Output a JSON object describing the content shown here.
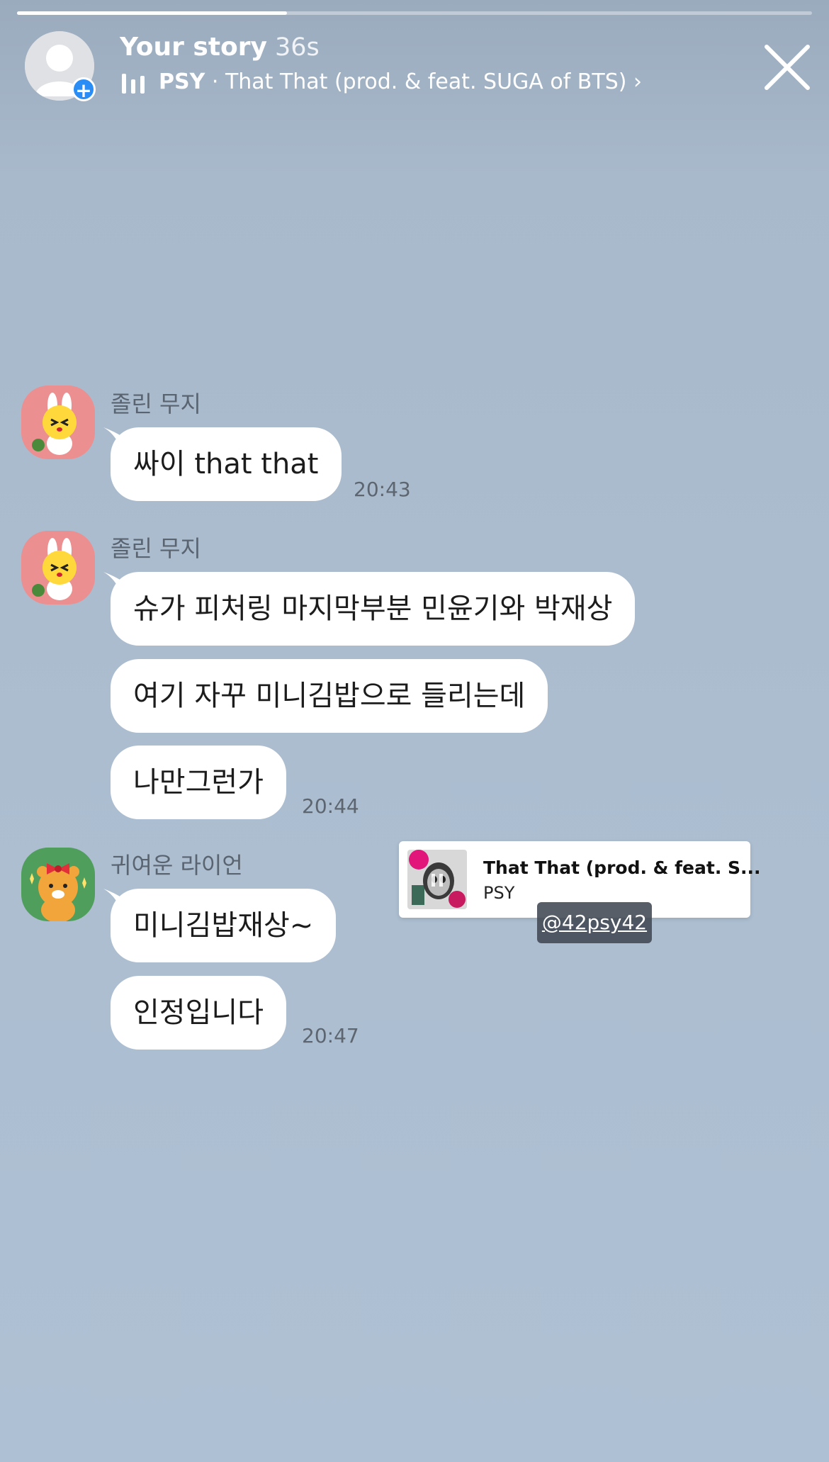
{
  "story": {
    "progress_fraction": 0.34,
    "title": "Your story",
    "elapsed": "36s",
    "music": {
      "artist": "PSY",
      "separator": " · ",
      "track": "That That (prod. & feat. SUGA of BTS)",
      "chevron": "›"
    },
    "add_badge": "+",
    "close_icon": "close-icon"
  },
  "chat": {
    "groups": [
      {
        "sender": "졸린 무지",
        "messages": [
          "싸이 that that"
        ],
        "time": "20:43"
      },
      {
        "sender": "졸린 무지",
        "messages": [
          "슈가 피처링 마지막부분 민윤기와 박재상",
          "여기 자꾸 미니김밥으로 들리는데",
          "나만그런가"
        ],
        "time": "20:44"
      },
      {
        "sender": "귀여운 라이언",
        "messages": [
          "미니김밥재상~",
          "인정입니다"
        ],
        "time": "20:47"
      }
    ]
  },
  "music_sticker": {
    "title": "That That (prod. & feat. S...",
    "artist": "PSY"
  },
  "mention": "@42psy42"
}
